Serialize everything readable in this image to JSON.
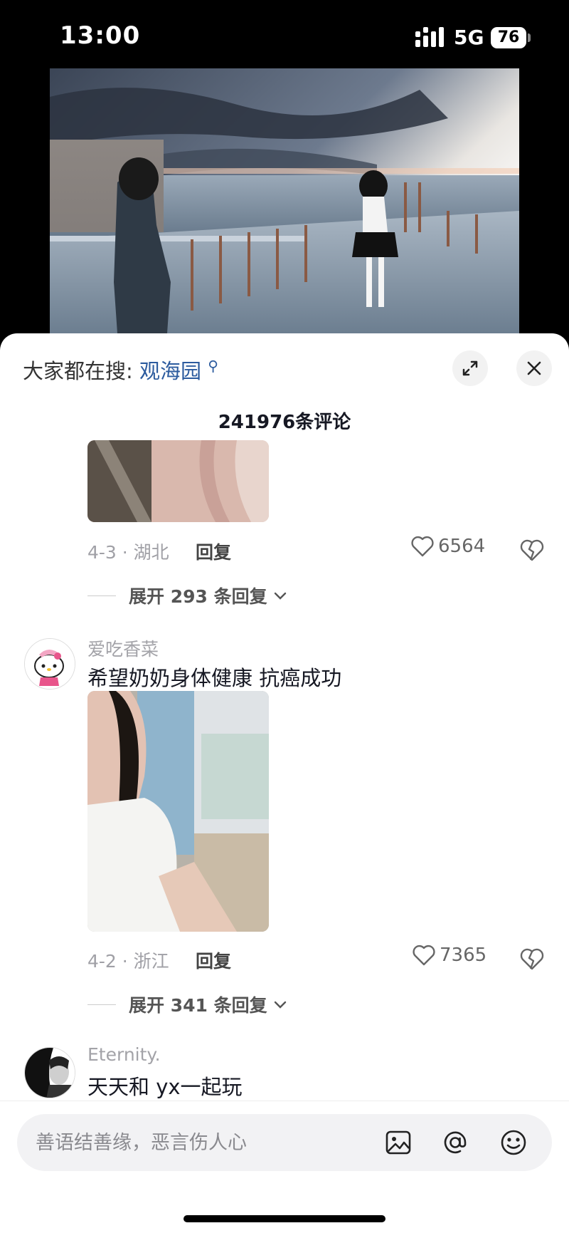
{
  "status_bar": {
    "time": "13:00",
    "network": "5G",
    "battery": "76"
  },
  "sheet": {
    "hot_search_prefix": "大家都在搜:",
    "hot_search_keyword": "观海园",
    "comment_count": "241976条评论"
  },
  "comments": [
    {
      "meta": "4-3 · 湖北",
      "reply_label": "回复",
      "likes": "6564",
      "expand_label": "展开 293 条回复"
    },
    {
      "username": "爱吃香菜",
      "text": "希望奶奶身体健康 抗癌成功",
      "meta": "4-2 · 浙江",
      "reply_label": "回复",
      "likes": "7365",
      "expand_label": "展开 341 条回复"
    },
    {
      "username": "Eternity.",
      "text": "天天和 yx一起玩"
    }
  ],
  "input": {
    "placeholder": "善语结善缘，恶言伤人心"
  },
  "icons": {
    "signal": "signal-bars-icon",
    "expand": "expand-icon",
    "close": "close-icon",
    "like": "heart-icon",
    "dislike": "broken-heart-icon",
    "chevron": "chevron-down-icon",
    "image": "image-icon",
    "mention": "at-icon",
    "emoji": "emoji-icon"
  }
}
